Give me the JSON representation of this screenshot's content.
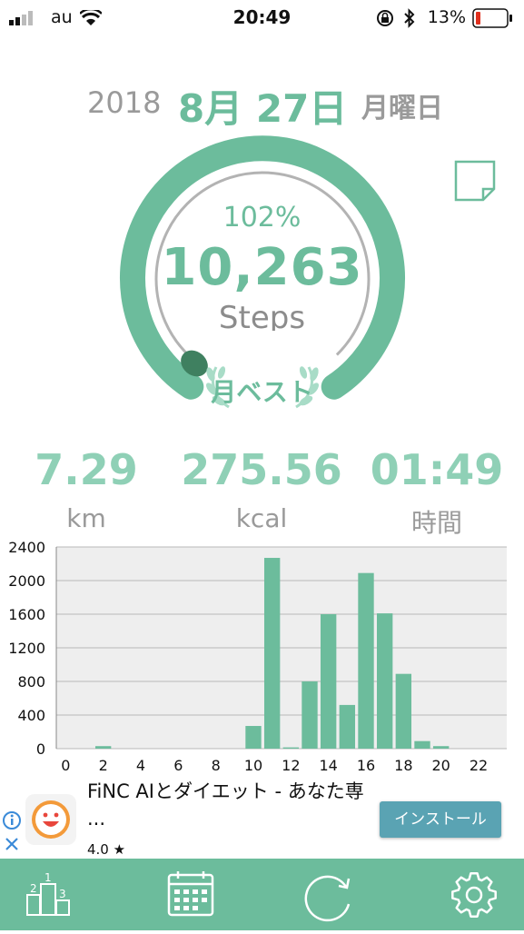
{
  "status_bar": {
    "carrier": "au",
    "time": "20:49",
    "battery": "13%"
  },
  "date": {
    "year": "2018",
    "month_day": "8月 27日",
    "weekday": "月曜日"
  },
  "goal_ring": {
    "percent_label": "102%",
    "percent_value": 1.02,
    "steps": "10,263",
    "unit": "Steps",
    "badge": "月ベスト"
  },
  "stats": {
    "distance": {
      "value": "7.29",
      "unit": "km"
    },
    "calories": {
      "value": "275.56",
      "unit": "kcal"
    },
    "time": {
      "value": "01:49",
      "unit": "時間"
    }
  },
  "chart_data": {
    "type": "bar",
    "x": [
      0,
      1,
      2,
      3,
      4,
      5,
      6,
      7,
      8,
      9,
      10,
      11,
      12,
      13,
      14,
      15,
      16,
      17,
      18,
      19,
      20,
      21,
      22,
      23
    ],
    "values": [
      0,
      0,
      30,
      0,
      0,
      0,
      0,
      0,
      0,
      0,
      270,
      2270,
      15,
      800,
      1600,
      520,
      2090,
      1610,
      890,
      90,
      30,
      0,
      0,
      0
    ],
    "xticks": [
      "0",
      "2",
      "4",
      "6",
      "8",
      "10",
      "12",
      "14",
      "16",
      "18",
      "20",
      "22"
    ],
    "yticks": [
      "0",
      "400",
      "800",
      "1200",
      "1600",
      "2000",
      "2400"
    ],
    "ylim": [
      0,
      2400
    ],
    "xlim": [
      -0.5,
      23.5
    ],
    "grid": true,
    "bar_color": "#6cbc9c",
    "background": "#eeeeee"
  },
  "ad": {
    "title": "FiNC AIとダイエット - あなた専 ...",
    "rating": "4.0 ★",
    "install_label": "インストール"
  },
  "colors": {
    "accent": "#6cbc9c",
    "accent_dark": "#3f8060",
    "install": "#5aa3b3"
  }
}
